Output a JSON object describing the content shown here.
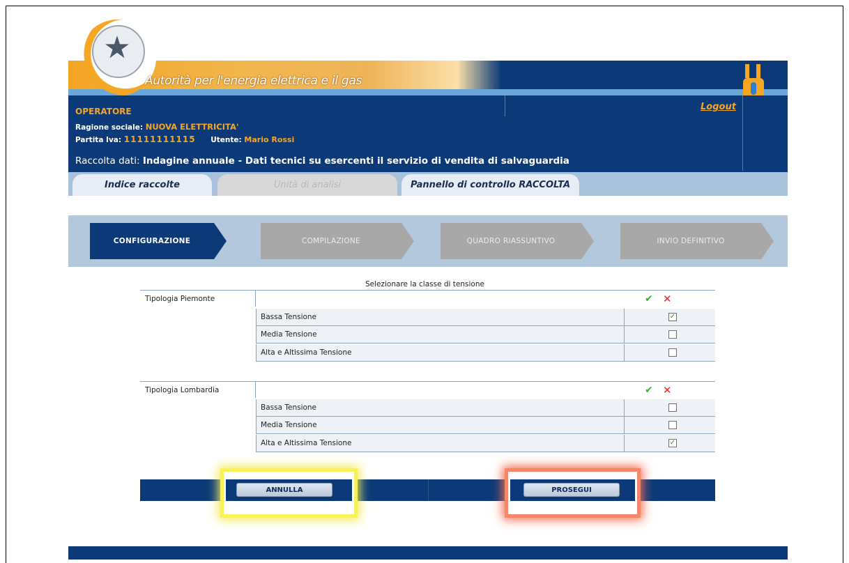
{
  "header": {
    "agency_title": "Autorità per l'energia elettrica e il gas",
    "logout_label": "Logout"
  },
  "operator": {
    "label": "OPERATORE",
    "ragione_label": "Ragione sociale:",
    "ragione_value": "NUOVA ELETTRICITA'",
    "partita_label": "Partita Iva:",
    "partita_value": "11111111115",
    "utente_label": "Utente:",
    "utente_value": "Mario Rossi"
  },
  "raccolta": {
    "label": "Raccolta dati:",
    "value": "Indagine annuale - Dati tecnici su esercenti il servizio di vendita di salvaguardia"
  },
  "tabs": [
    {
      "label": "Indice raccolte",
      "state": "active"
    },
    {
      "label": "Unità di analisi",
      "state": "disabled"
    },
    {
      "label": "Pannello di controllo RACCOLTA",
      "state": "active"
    }
  ],
  "steps": [
    {
      "label": "CONFIGURAZIONE",
      "state": "current"
    },
    {
      "label": "COMPILAZIONE",
      "state": "inactive"
    },
    {
      "label": "QUADRO RIASSUNTIVO",
      "state": "inactive"
    },
    {
      "label": "INVIO DEFINITIVO",
      "state": "inactive"
    }
  ],
  "selection_prompt": "Selezionare la classe di tensione",
  "icons": {
    "select_all": "check-icon",
    "deselect_all": "cross-icon",
    "check_glyph": "✔",
    "cross_glyph": "✕",
    "checked_glyph": "✓"
  },
  "groups": [
    {
      "title": "Tipologia Piemonte",
      "rows": [
        {
          "label": "Bassa Tensione",
          "checked": true
        },
        {
          "label": "Media Tensione",
          "checked": false
        },
        {
          "label": "Alta e Altissima Tensione",
          "checked": false
        }
      ]
    },
    {
      "title": "Tipologia Lombardia",
      "rows": [
        {
          "label": "Bassa Tensione",
          "checked": false
        },
        {
          "label": "Media Tensione",
          "checked": false
        },
        {
          "label": "Alta e Altissima Tensione",
          "checked": true
        }
      ]
    }
  ],
  "actions": {
    "cancel_label": "ANNULLA",
    "proceed_label": "PROSEGUI"
  },
  "colors": {
    "navy": "#0c3a78",
    "orange": "#f5a623",
    "highlight_yellow": "#f7f25a",
    "highlight_red": "#f26d51",
    "check_green": "#2fb52f",
    "cross_red": "#e0262b"
  }
}
